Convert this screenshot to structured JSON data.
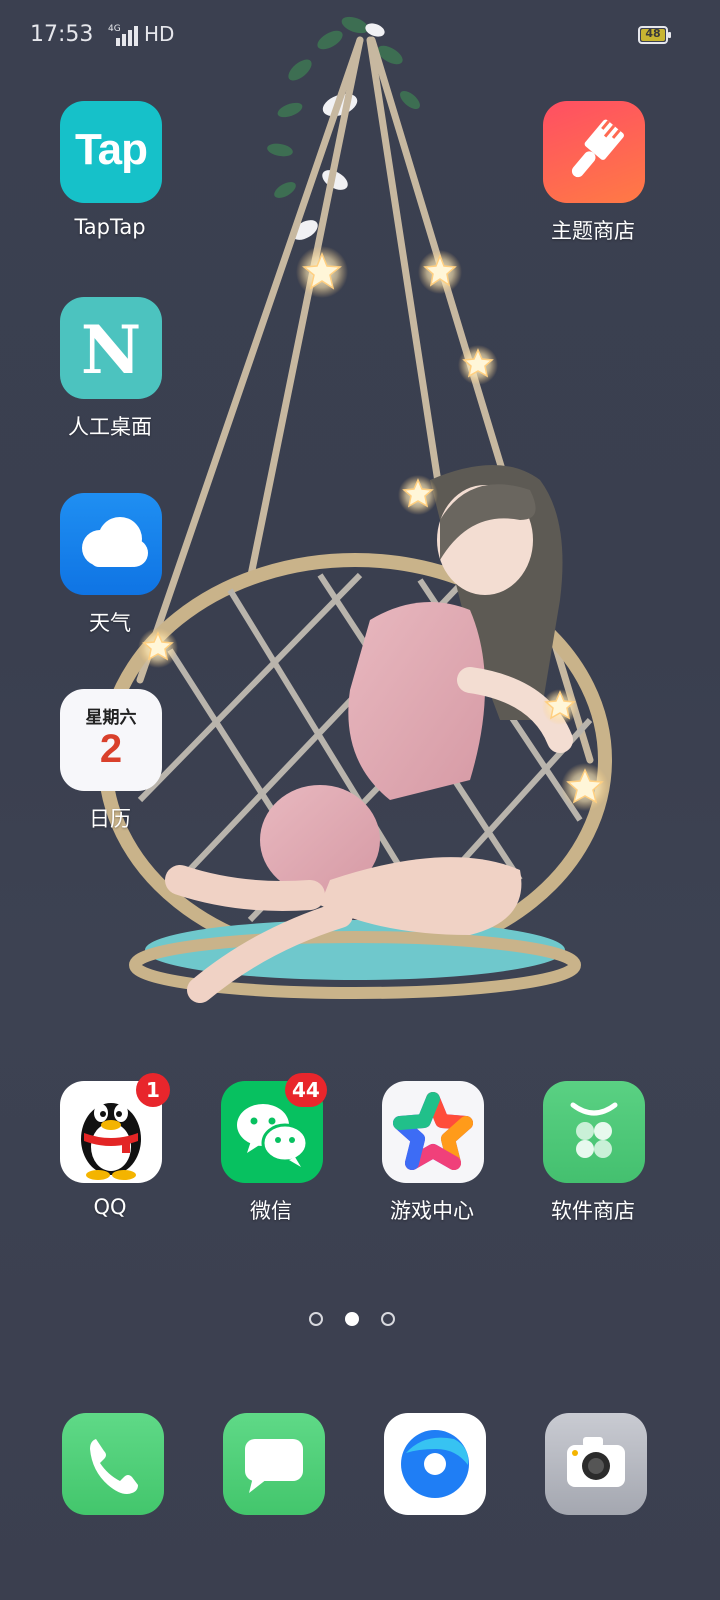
{
  "status_bar": {
    "time": "17:53",
    "network": "4G",
    "hd": "HD",
    "battery": "48"
  },
  "apps": {
    "taptap": {
      "label": "TapTap",
      "logo": "Tap"
    },
    "theme_store": {
      "label": "主题商店"
    },
    "rengong": {
      "label": "人工桌面",
      "logo": "N"
    },
    "weather": {
      "label": "天气"
    },
    "calendar": {
      "label": "日历",
      "weekday": "星期六",
      "day": "2"
    },
    "qq": {
      "label": "QQ",
      "badge": "1"
    },
    "wechat": {
      "label": "微信",
      "badge": "44"
    },
    "game_center": {
      "label": "游戏中心"
    },
    "app_store": {
      "label": "软件商店"
    }
  },
  "page_indicator": {
    "pages": 3,
    "current": 2
  },
  "dock": {
    "icons": [
      "phone-icon",
      "messages-icon",
      "browser-icon",
      "camera-icon"
    ]
  },
  "colors": {
    "badge": "#e8262c",
    "taptap": "#16c1c9",
    "theme_store": "#ff5a5f",
    "rengong": "#4cc3bf",
    "weather": "#1a86f0",
    "wechat": "#07c160",
    "app_store": "#4fc978",
    "phone": "#4fcf74",
    "messages": "#4fcf74"
  }
}
